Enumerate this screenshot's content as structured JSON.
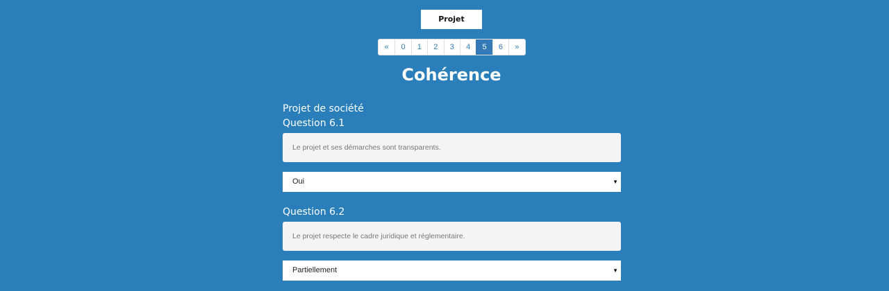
{
  "top_button": {
    "label": "Projet"
  },
  "pagination": {
    "items": [
      "«",
      "0",
      "1",
      "2",
      "3",
      "4",
      "5",
      "6",
      "»"
    ],
    "active_index": 6
  },
  "page_title": "Cohérence",
  "section": {
    "label": "Projet de société"
  },
  "questions": [
    {
      "label": "Question 6.1",
      "text": "Le projet et ses démarches sont transparents.",
      "answer": "Oui"
    },
    {
      "label": "Question 6.2",
      "text": "Le projet respecte le cadre juridique et réglementaire.",
      "answer": "Partiellement"
    }
  ],
  "icons": {
    "select_caret": "caret-down-icon"
  },
  "colors": {
    "background": "#2a7fba",
    "link": "#337ab7",
    "active_page": "#337ab7"
  }
}
